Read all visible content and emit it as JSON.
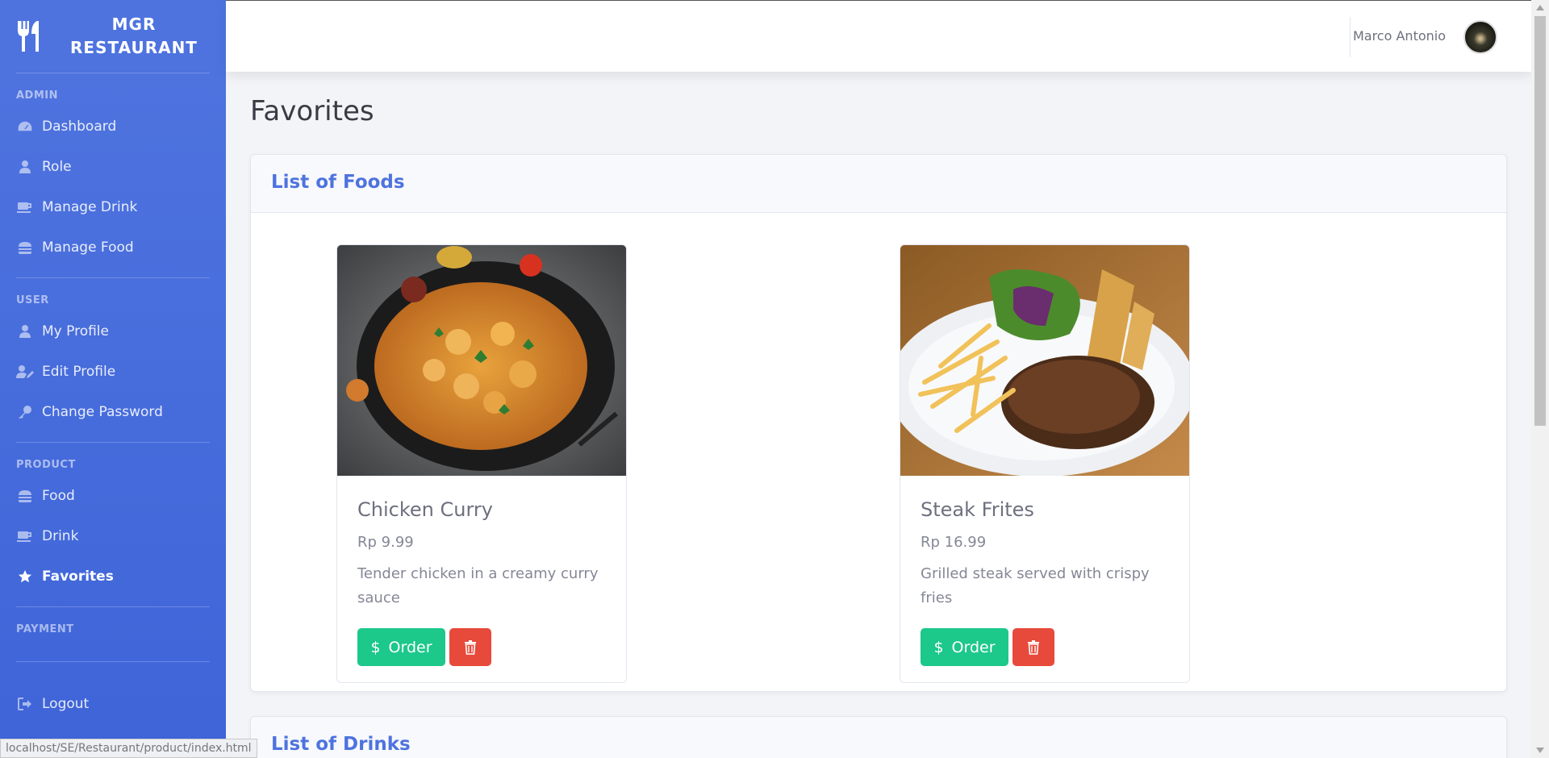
{
  "brand": {
    "line1": "MGR",
    "line2": "RESTAURANT"
  },
  "sidebar": {
    "sections": [
      {
        "heading": "ADMIN",
        "items": [
          {
            "label": "Dashboard",
            "icon": "dashboard-icon"
          },
          {
            "label": "Role",
            "icon": "user-icon"
          },
          {
            "label": "Manage Drink",
            "icon": "mug-icon"
          },
          {
            "label": "Manage Food",
            "icon": "burger-icon"
          }
        ]
      },
      {
        "heading": "USER",
        "items": [
          {
            "label": "My Profile",
            "icon": "user-icon"
          },
          {
            "label": "Edit Profile",
            "icon": "user-edit-icon"
          },
          {
            "label": "Change Password",
            "icon": "key-icon"
          }
        ]
      },
      {
        "heading": "PRODUCT",
        "items": [
          {
            "label": "Food",
            "icon": "burger-icon"
          },
          {
            "label": "Drink",
            "icon": "mug-icon"
          },
          {
            "label": "Favorites",
            "icon": "star-icon",
            "active": true
          }
        ]
      },
      {
        "heading": "PAYMENT",
        "items": []
      }
    ],
    "logout": "Logout"
  },
  "topbar": {
    "user_name": "Marco Antonio"
  },
  "page": {
    "title": "Favorites"
  },
  "foods": {
    "header": "List of Foods",
    "items": [
      {
        "name": "Chicken Curry",
        "price": "Rp 9.99",
        "description": "Tender chicken in a creamy curry sauce",
        "order_label": "Order"
      },
      {
        "name": "Steak Frites",
        "price": "Rp 16.99",
        "description": "Grilled steak served with crispy fries",
        "order_label": "Order"
      }
    ]
  },
  "drinks": {
    "header": "List of Drinks"
  },
  "statusbar": {
    "url": "localhost/SE/Restaurant/product/index.html"
  },
  "colors": {
    "primary": "#4e73df",
    "success": "#1cc88a",
    "danger": "#e74a3b"
  }
}
